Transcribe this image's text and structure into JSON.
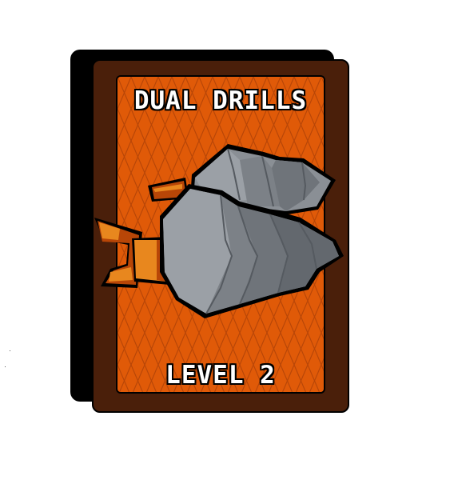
{
  "card": {
    "title": "DUAL DRILLS",
    "level_label": "LEVEL 2",
    "art_icon": "dual-drill-icon"
  },
  "colors": {
    "frame": "#4a1f0a",
    "face": "#e05a08",
    "pattern": "#b84607",
    "shadow": "#000000",
    "drill_metal": "#858a90",
    "drill_handle": "#e8871e"
  }
}
